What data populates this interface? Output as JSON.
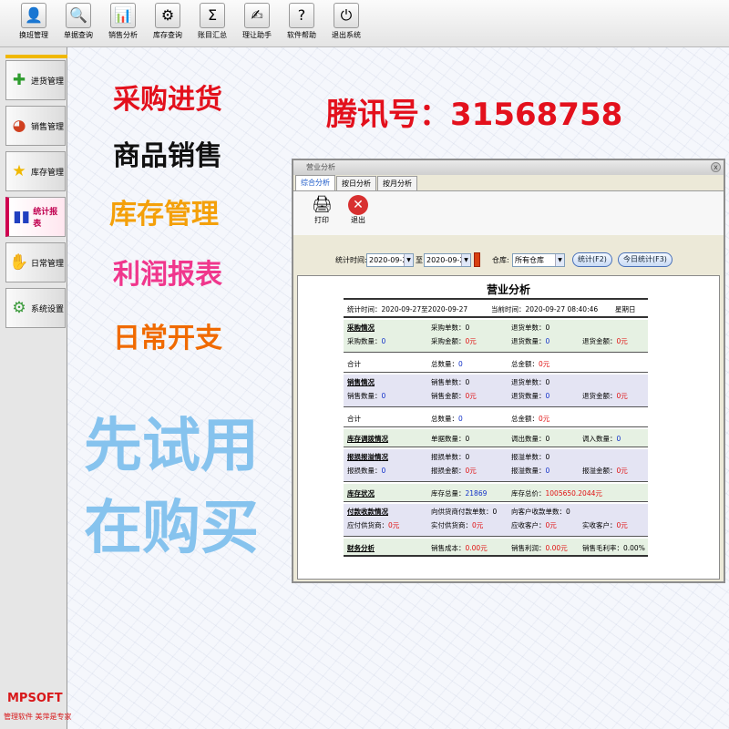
{
  "toolbar": {
    "items": [
      {
        "label": "换班管理",
        "icon": "person-icon",
        "glyph": "👤"
      },
      {
        "label": "单据查询",
        "icon": "search-icon",
        "glyph": "🔍"
      },
      {
        "label": "销售分析",
        "icon": "bar-chart-icon",
        "glyph": "📊"
      },
      {
        "label": "库存查询",
        "icon": "boxes-icon",
        "glyph": "⚙"
      },
      {
        "label": "账目汇总",
        "icon": "sigma-icon",
        "glyph": "Σ"
      },
      {
        "label": "理让助手",
        "icon": "handshake-icon",
        "glyph": "✍"
      },
      {
        "label": "软件帮助",
        "icon": "help-icon",
        "glyph": "?"
      },
      {
        "label": "退出系统",
        "icon": "exit-icon",
        "glyph": "⏻"
      }
    ]
  },
  "sidebar": {
    "items": [
      {
        "label": "进货管理",
        "icon": "plus-icon",
        "glyph": "✚",
        "color": "#2e9c2e"
      },
      {
        "label": "销售管理",
        "icon": "pie-icon",
        "glyph": "◕",
        "color": "#d04020"
      },
      {
        "label": "库存管理",
        "icon": "star-icon",
        "glyph": "★",
        "color": "#f0b800"
      },
      {
        "label": "统计报表",
        "icon": "chart-icon",
        "glyph": "▮▮",
        "color": "#2040c0"
      },
      {
        "label": "日常管理",
        "icon": "handshake-icon",
        "glyph": "✋",
        "color": "#d06020"
      },
      {
        "label": "系统设置",
        "icon": "gear-icon",
        "glyph": "⚙",
        "color": "#3a9a3a"
      }
    ],
    "brand": "MPSOFT",
    "brand_sub": "管理软件 美萍是专家"
  },
  "promo": {
    "l1": "采购进货",
    "l2": "商品销售",
    "l3": "库存管理",
    "l4": "利润报表",
    "l5": "日常开支",
    "qq": "腾讯号：31568758",
    "try1": "先试用",
    "try2": "在购买"
  },
  "window": {
    "title": "营业分析",
    "close": "x",
    "tabs": [
      "综合分析",
      "按日分析",
      "按月分析"
    ],
    "print_label": "打印",
    "exit_label": "退出",
    "print_glyph": "🖨",
    "exit_glyph": "✕",
    "filter": {
      "time_label": "统计时间:",
      "from": "2020-09-27",
      "to_label": "至",
      "to": "2020-09-27",
      "wh_label": "仓库:",
      "wh_value": "所有仓库",
      "stat_btn": "统计(F2)",
      "today_btn": "今日统计(F3)",
      "arrow": "▼"
    },
    "report": {
      "title": "营业分析",
      "period": "统计时间：2020-09-27至2020-09-27",
      "now": "当前时间：2020-09-27 08:40:46",
      "weekday": "星期日",
      "purchase": {
        "title": "采购情况",
        "l1": "采购单数：",
        "v1": "0",
        "l2": "退货单数：",
        "v2": "0",
        "l3": "采购数量：",
        "v3": "0",
        "l4": "采购金额：",
        "v4": "0元",
        "l5": "退货数量：",
        "v5": "0",
        "l6": "退货金额：",
        "v6": "0元"
      },
      "purchase_total": {
        "l1": "合计",
        "l2": "总数量：",
        "v2": "0",
        "l3": "总金额：",
        "v3": "0元"
      },
      "sales": {
        "title": "销售情况",
        "l1": "销售单数：",
        "v1": "0",
        "l2": "退货单数：",
        "v2": "0",
        "l3": "销售数量：",
        "v3": "0",
        "l4": "销售金额：",
        "v4": "0元",
        "l5": "退货数量：",
        "v5": "0",
        "l6": "退货金额：",
        "v6": "0元"
      },
      "sales_total": {
        "l1": "合计",
        "l2": "总数量：",
        "v2": "0",
        "l3": "总金额：",
        "v3": "0元"
      },
      "transfer": {
        "title": "库存调拨情况",
        "l1": "单据数量：",
        "v1": "0",
        "l2": "调出数量：",
        "v2": "0",
        "l3": "调入数量：",
        "v3": "0"
      },
      "loss": {
        "title": "报损报溢情况",
        "l1": "报损单数：",
        "v1": "0",
        "l2": "报溢单数：",
        "v2": "0",
        "l3": "报损数量：",
        "v3": "0",
        "l4": "报损金额：",
        "v4": "0元",
        "l5": "报溢数量：",
        "v5": "0",
        "l6": "报溢金额：",
        "v6": "0元"
      },
      "stock": {
        "title": "库存状况",
        "l1": "库存总量：",
        "v1": "21869",
        "l2": "库存总价：",
        "v2": "1005650.2044元"
      },
      "payment": {
        "title": "付款收款情况",
        "l1": "向供货商付款单数：",
        "v1": "0",
        "l2": "向客户收款单数：",
        "v2": "0",
        "l3": "应付供货商：",
        "v3": "0元",
        "l4": "实付供货商：",
        "v4": "0元",
        "l5": "应收客户：",
        "v5": "0元",
        "l6": "实收客户：",
        "v6": "0元"
      },
      "finance": {
        "title": "财务分析",
        "l1": "销售成本：",
        "v1": "0.00元",
        "l2": "销售利润：",
        "v2": "0.00元",
        "l3": "销售毛利率：",
        "v3": "0.00%"
      }
    }
  }
}
